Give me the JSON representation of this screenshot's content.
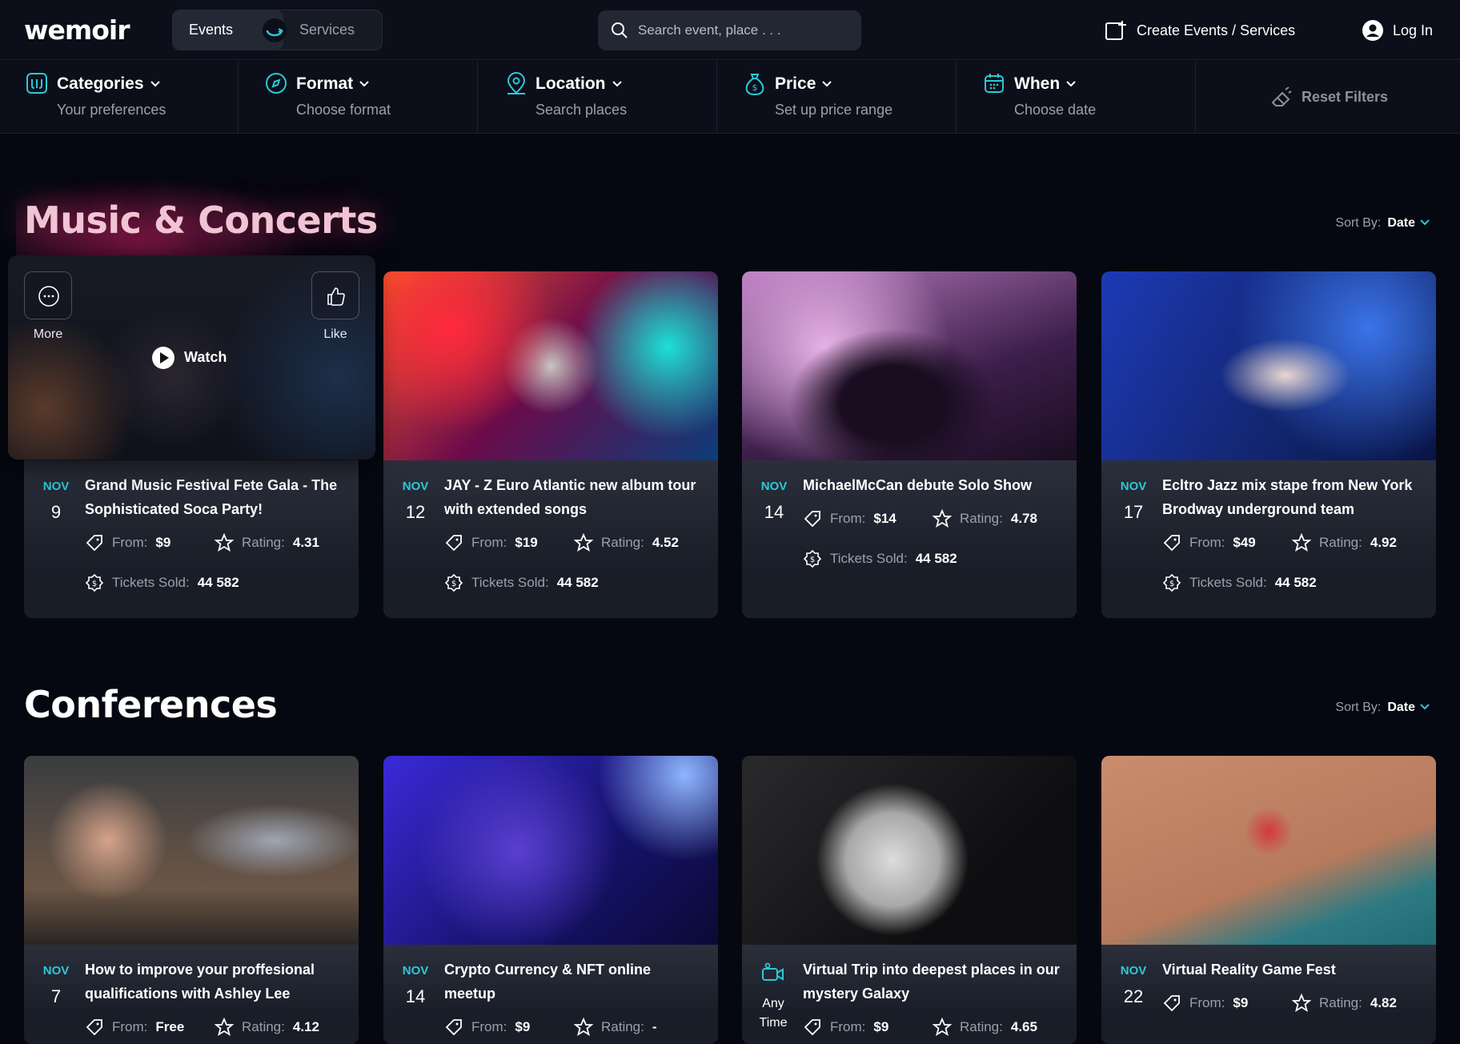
{
  "header": {
    "logo": "wemoir",
    "toggle": {
      "events": "Events",
      "services": "Services"
    },
    "search_placeholder": "Search event, place . . .",
    "create_label": "Create Events / Services",
    "login_label": "Log In"
  },
  "filters": {
    "categories": {
      "title": "Categories",
      "sub": "Your preferences"
    },
    "format": {
      "title": "Format",
      "sub": "Choose format"
    },
    "location": {
      "title": "Location",
      "sub": "Search places"
    },
    "price": {
      "title": "Price",
      "sub": "Set up price range"
    },
    "when": {
      "title": "When",
      "sub": "Choose date"
    },
    "reset": "Reset Filters"
  },
  "labels": {
    "from": "From:",
    "rating": "Rating:",
    "tickets": "Tickets Sold:",
    "sort_by": "Sort By:",
    "sort_value": "Date",
    "more": "More",
    "like": "Like",
    "watch": "Watch"
  },
  "music": {
    "title": "Music & Concerts",
    "cards": [
      {
        "month": "NOV",
        "day": "9",
        "title": "Grand Music Festival Fete Gala - The Sophisticated Soca Party!",
        "price": "$9",
        "rating": "4.31",
        "tickets": "44 582"
      },
      {
        "month": "NOV",
        "day": "12",
        "title": "JAY - Z Euro Atlantic new album tour with extended songs",
        "price": "$19",
        "rating": "4.52",
        "tickets": "44 582"
      },
      {
        "month": "NOV",
        "day": "14",
        "title": "MichaelMcCan debute Solo Show",
        "price": "$14",
        "rating": "4.78",
        "tickets": "44 582"
      },
      {
        "month": "NOV",
        "day": "17",
        "title": "Ecltro Jazz mix stape from New York Brodway underground team",
        "price": "$49",
        "rating": "4.92",
        "tickets": "44 582"
      }
    ]
  },
  "conferences": {
    "title": "Conferences",
    "cards": [
      {
        "month": "NOV",
        "day": "7",
        "title": "How to improve your proffesional qualifications with Ashley Lee",
        "price": "Free",
        "rating": "4.12"
      },
      {
        "month": "NOV",
        "day": "14",
        "title": "Crypto Currency & NFT online meetup",
        "price": "$9",
        "rating": "-"
      },
      {
        "anytime": "Any Time",
        "title": "Virtual Trip into deepest places in our mystery Galaxy",
        "price": "$9",
        "rating": "4.65"
      },
      {
        "month": "NOV",
        "day": "22",
        "title": "Virtual Reality Game Fest",
        "price": "$9",
        "rating": "4.82"
      }
    ]
  },
  "colors": {
    "accent": "#2cc9d7",
    "background": "#050811",
    "card": "#1a1e29"
  }
}
